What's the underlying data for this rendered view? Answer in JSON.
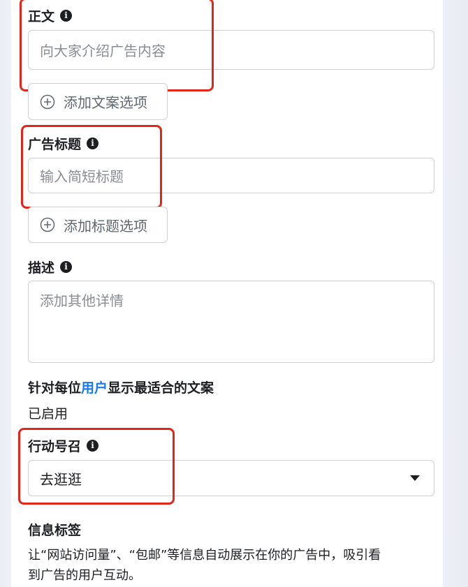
{
  "primary_text": {
    "label": "正文",
    "placeholder": "向大家介绍广告内容",
    "add_option_label": "添加文案选项"
  },
  "headline": {
    "label": "广告标题",
    "placeholder": "输入简短标题",
    "add_option_label": "添加标题选项"
  },
  "description": {
    "label": "描述",
    "placeholder": "添加其他详情"
  },
  "optimize": {
    "title_before": "针对每位",
    "title_link": "用户",
    "title_after": "显示最适合的文案",
    "status": "已启用"
  },
  "call_to_action": {
    "label": "行动号召",
    "selected": "去逛逛"
  },
  "info_labels": {
    "title": "信息标签",
    "body_line1": "让“网站访问量”、“包邮”等信息自动展示在你的广告中，吸引看",
    "body_line2": "到广告的用户互动。"
  },
  "icons": {
    "info": "info-icon",
    "plus": "plus-circle-icon",
    "caret": "caret-down-icon"
  },
  "colors": {
    "highlight": "#e0271a",
    "link": "#1877f2"
  }
}
